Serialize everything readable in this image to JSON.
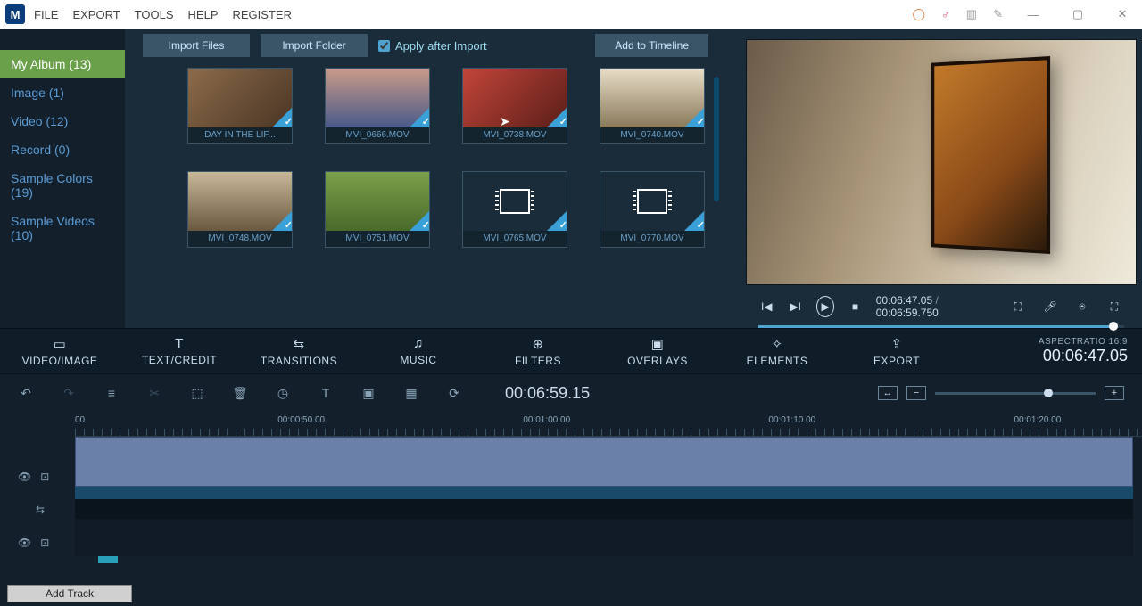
{
  "menubar": {
    "items": [
      "FILE",
      "EXPORT",
      "TOOLS",
      "HELP",
      "REGISTER"
    ]
  },
  "sidebar": {
    "items": [
      {
        "label": "My Album (13)",
        "active": true
      },
      {
        "label": "Image (1)"
      },
      {
        "label": "Video (12)"
      },
      {
        "label": "Record (0)"
      },
      {
        "label": "Sample Colors (19)"
      },
      {
        "label": "Sample Videos (10)"
      }
    ]
  },
  "toolbar": {
    "import_files": "Import Files",
    "import_folder": "Import Folder",
    "apply_after_import": "Apply after Import",
    "add_to_timeline": "Add to Timeline"
  },
  "media": {
    "items": [
      {
        "label": "DAY IN THE LIF...",
        "thumb": "room"
      },
      {
        "label": "MVI_0666.MOV",
        "thumb": "person"
      },
      {
        "label": "MVI_0738.MOV",
        "thumb": "sofa"
      },
      {
        "label": "MVI_0740.MOV",
        "thumb": "hall"
      },
      {
        "label": "MVI_0748.MOV",
        "thumb": "patio"
      },
      {
        "label": "MVI_0751.MOV",
        "thumb": "grass"
      },
      {
        "label": "MVI_0765.MOV",
        "thumb": "plh"
      },
      {
        "label": "MVI_0770.MOV",
        "thumb": "plh"
      }
    ]
  },
  "preview": {
    "current": "00:06:47.05",
    "total": "00:06:59.750"
  },
  "modetabs": {
    "items": [
      {
        "label": "VIDEO/IMAGE",
        "icon": "▭"
      },
      {
        "label": "TEXT/CREDIT",
        "icon": "T"
      },
      {
        "label": "TRANSITIONS",
        "icon": "⇆"
      },
      {
        "label": "MUSIC",
        "icon": "♫"
      },
      {
        "label": "FILTERS",
        "icon": "⊕"
      },
      {
        "label": "OVERLAYS",
        "icon": "▣"
      },
      {
        "label": "ELEMENTS",
        "icon": "✧"
      },
      {
        "label": "EXPORT",
        "icon": "⇪"
      }
    ],
    "aspect_label": "ASPECTRATIO 16:9",
    "aspect_time": "00:06:47.05"
  },
  "editrow": {
    "time": "00:06:59.15"
  },
  "ruler": {
    "marks": [
      {
        "label": "00",
        "pos": 0
      },
      {
        "label": "00:00:50.00",
        "pos": 19
      },
      {
        "label": "00:01:00.00",
        "pos": 42
      },
      {
        "label": "00:01:10.00",
        "pos": 65
      },
      {
        "label": "00:01:20.00",
        "pos": 88
      }
    ]
  },
  "addtrack": "Add Track"
}
